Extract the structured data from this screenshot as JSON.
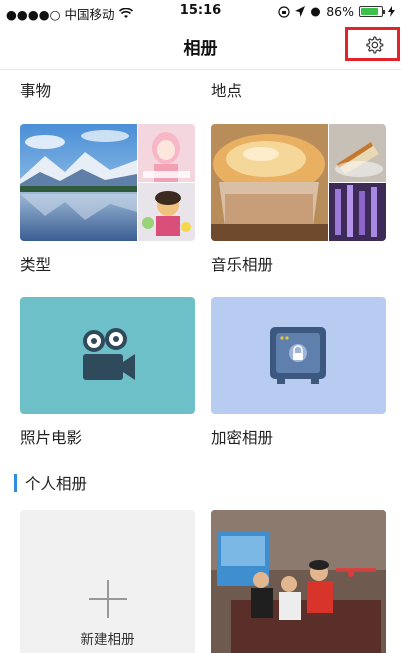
{
  "status_bar": {
    "carrier": "●●●●○ 中国移动",
    "time": "15:16",
    "battery": "86%",
    "battery_level": 0.86
  },
  "nav": {
    "title": "相册",
    "settings_icon": "gear-icon"
  },
  "categories": {
    "things_label": "事物",
    "places_label": "地点",
    "types_label": "类型",
    "music_albums_label": "音乐相册",
    "photo_movie_label": "照片电影",
    "encrypted_albums_label": "加密相册"
  },
  "personal": {
    "section_title": "个人相册",
    "new_album_label": "新建相册"
  },
  "colors": {
    "accent": "#2e8de3",
    "highlight": "#e3232a",
    "photo_movie_bg": "#6dbfc8",
    "encrypted_bg": "#b8ccf2"
  }
}
